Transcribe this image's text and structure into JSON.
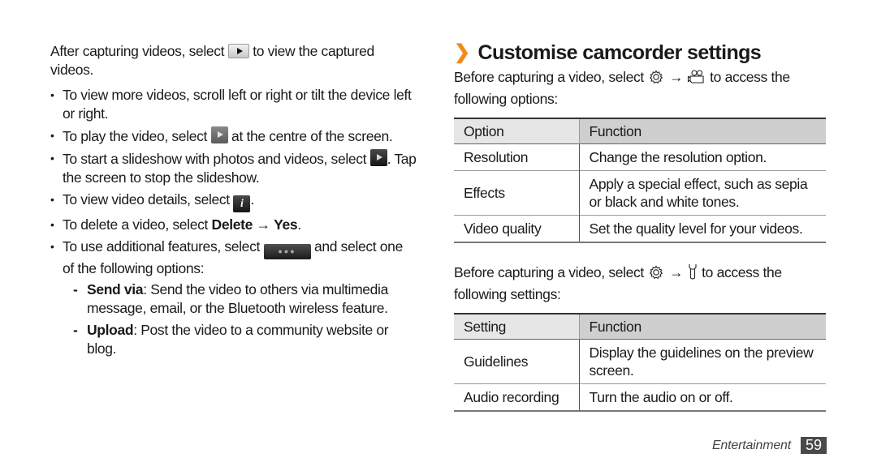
{
  "left": {
    "intro": {
      "before": "After capturing videos, select ",
      "icon": "play-icon",
      "after": " to view the captured videos."
    },
    "bullets": [
      {
        "text": "To view more videos, scroll left or right or tilt the device left or right."
      },
      {
        "before": "To play the video, select ",
        "icon": "play-center-icon",
        "after": " at the centre of the screen."
      },
      {
        "before": "To start a slideshow with photos and videos, select ",
        "icon": "slideshow-icon",
        "after": ". Tap the screen to stop the slideshow."
      },
      {
        "before": "To view video details, select ",
        "icon": "info-icon",
        "after": "."
      },
      {
        "before": "To delete a video, select ",
        "bold1": "Delete",
        "arrow": " → ",
        "bold2": "Yes",
        "after": "."
      },
      {
        "before": "To use additional features, select ",
        "icon": "more-icon",
        "after": " and select one of the following options:"
      }
    ],
    "sub_options": [
      {
        "label": "Send via",
        "text": ": Send the video to others via multimedia message, email, or the Bluetooth wireless feature."
      },
      {
        "label": "Upload",
        "text": ": Post the video to a community website or blog."
      }
    ]
  },
  "right": {
    "section_title": "Customise camcorder settings",
    "chevron": "❯",
    "options_intro": {
      "before": "Before capturing a video, select ",
      "icon1": "settings-gear-icon",
      "arrow": " → ",
      "icon2": "camcorder-icon",
      "after": " to access the following options:"
    },
    "options_table": {
      "headers": [
        "Option",
        "Function"
      ],
      "rows": [
        [
          "Resolution",
          "Change the resolution option."
        ],
        [
          "Effects",
          "Apply a special effect, such as sepia or black and white tones."
        ],
        [
          "Video quality",
          "Set the quality level for your videos."
        ]
      ]
    },
    "settings_intro": {
      "before": "Before capturing a video, select ",
      "icon1": "settings-gear-icon",
      "arrow": " → ",
      "icon2": "wrench-icon",
      "after": " to access the following settings:"
    },
    "settings_table": {
      "headers": [
        "Setting",
        "Function"
      ],
      "rows": [
        [
          "Guidelines",
          "Display the guidelines on the preview screen."
        ],
        [
          "Audio recording",
          "Turn the audio on or off."
        ]
      ]
    }
  },
  "footer": {
    "section": "Entertainment",
    "page_number": "59"
  },
  "colors": {
    "accent_chevron": "#f08a1c",
    "header_cell_1": "#e6e6e6",
    "header_cell_2": "#cfcfcf",
    "page_badge": "#4a4a4a"
  }
}
